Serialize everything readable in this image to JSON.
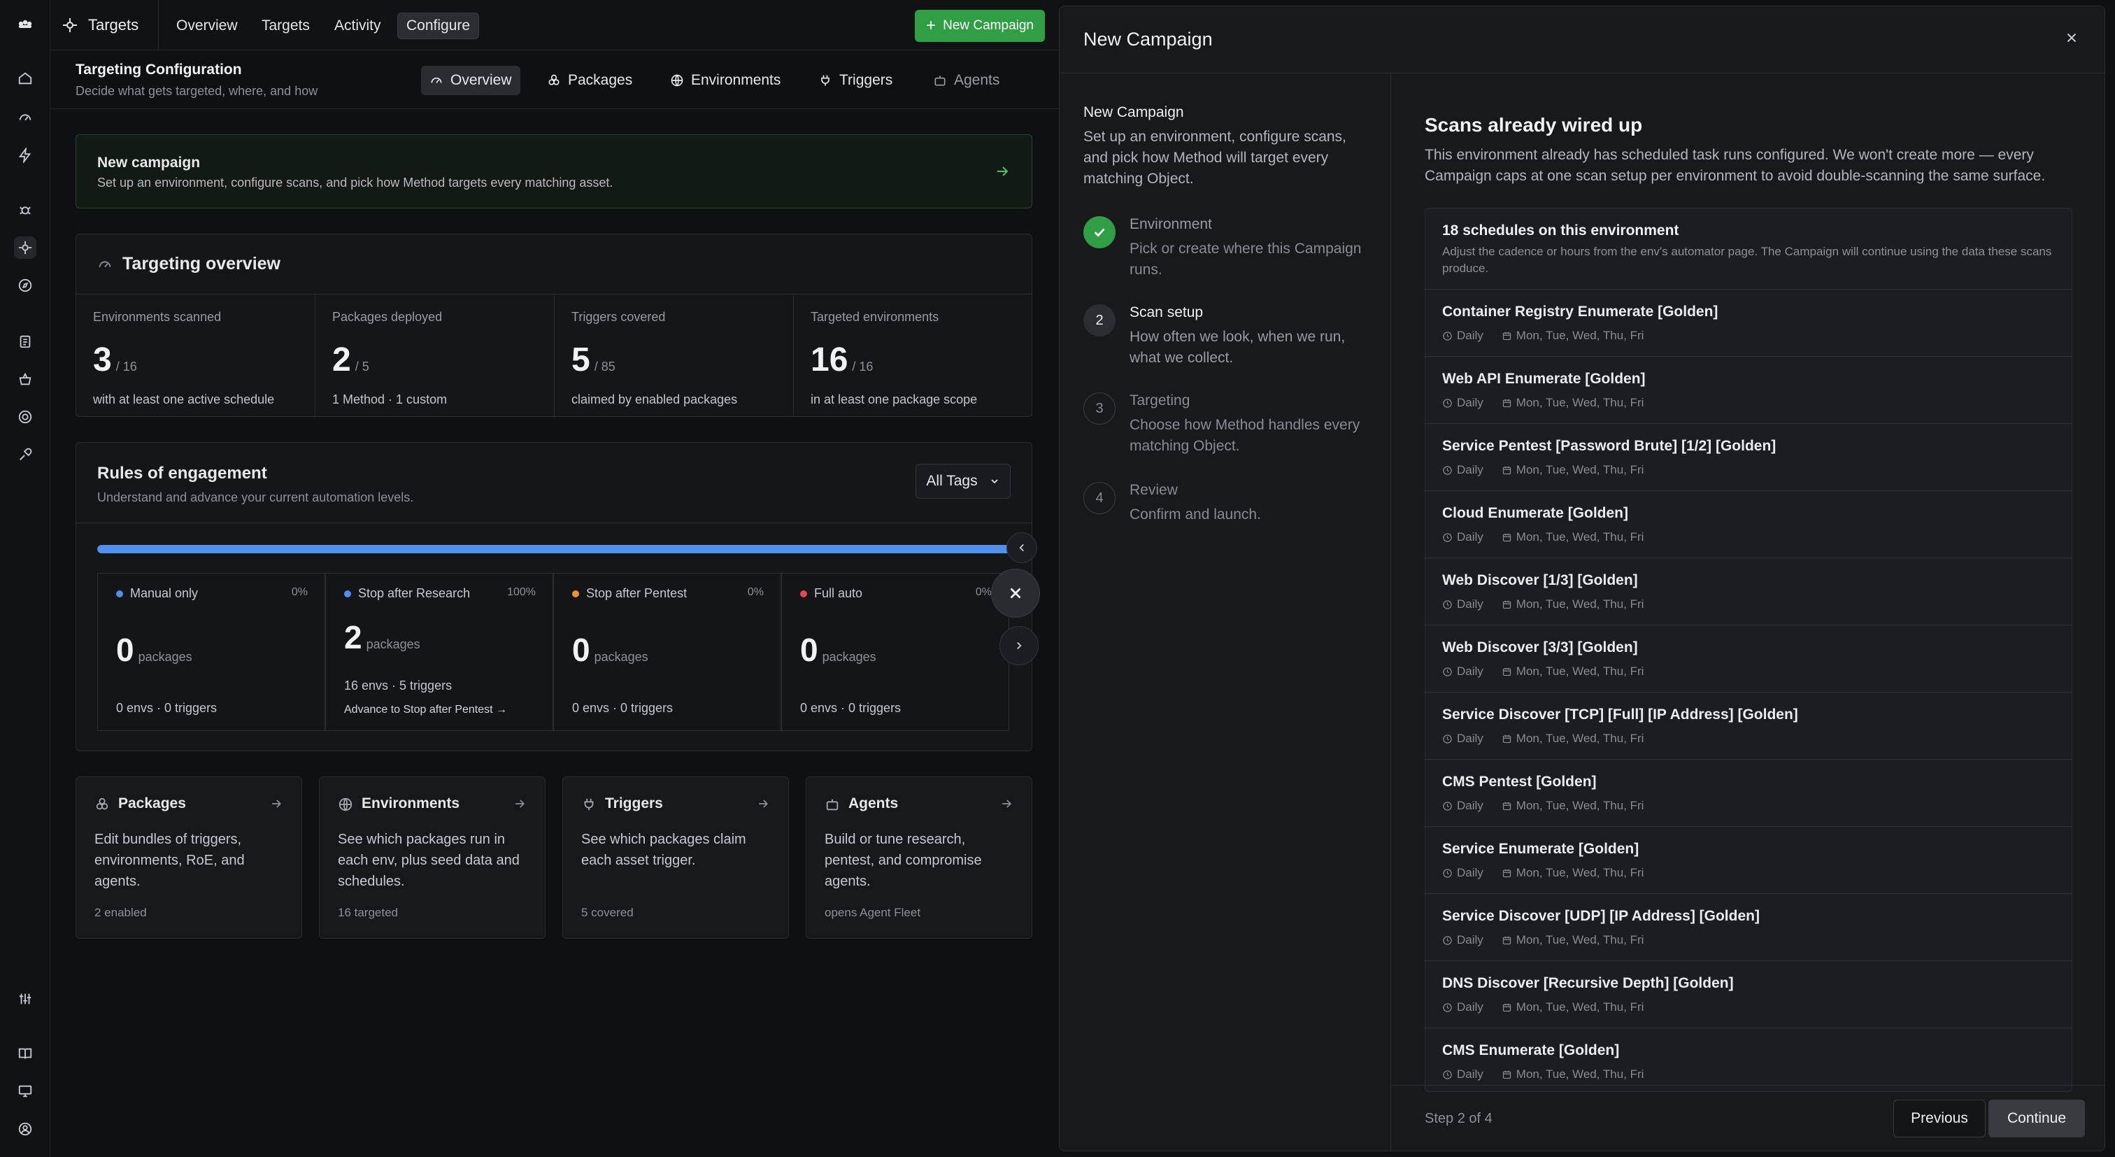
{
  "brand": {
    "label": "Targets"
  },
  "topnav": [
    {
      "label": "Overview"
    },
    {
      "label": "Targets"
    },
    {
      "label": "Activity"
    },
    {
      "label": "Configure"
    }
  ],
  "new_campaign_button": "New Campaign",
  "subheader": {
    "title": "Targeting Configuration",
    "desc": "Decide what gets targeted, where, and how",
    "tabs": [
      {
        "label": "Overview",
        "icon": "gauge-icon"
      },
      {
        "label": "Packages",
        "icon": "packages-icon"
      },
      {
        "label": "Environments",
        "icon": "globe-icon"
      },
      {
        "label": "Triggers",
        "icon": "plug-icon"
      },
      {
        "label": "Agents",
        "icon": "bot-icon"
      }
    ]
  },
  "new_campaign_card": {
    "title": "New campaign",
    "desc": "Set up an environment, configure scans, and pick how Method targets every matching asset."
  },
  "targeting_overview": {
    "title": "Targeting overview",
    "stats": [
      {
        "label": "Environments scanned",
        "value": "3",
        "total": "/ 16",
        "foot": "with at least one active schedule"
      },
      {
        "label": "Packages deployed",
        "value": "2",
        "total": "/ 5",
        "foot": "1 Method · 1 custom"
      },
      {
        "label": "Triggers covered",
        "value": "5",
        "total": "/ 85",
        "foot": "claimed by enabled packages"
      },
      {
        "label": "Targeted environments",
        "value": "16",
        "total": "/ 16",
        "foot": "in at least one package scope"
      }
    ]
  },
  "roe": {
    "title": "Rules of engagement",
    "desc": "Understand and advance your current automation levels.",
    "tags_button": "All Tags",
    "progress_fraction": 1.0,
    "levels": [
      {
        "name": "Manual only",
        "pct": "0%",
        "count": "0",
        "unit": "packages",
        "foot": "0 envs · 0 triggers",
        "color": "#4f8ff0"
      },
      {
        "name": "Stop after Research",
        "pct": "100%",
        "count": "2",
        "unit": "packages",
        "foot": "16 envs · 5 triggers",
        "advance": "Advance to Stop after Pentest →",
        "color": "#4f8ff0"
      },
      {
        "name": "Stop after Pentest",
        "pct": "0%",
        "count": "0",
        "unit": "packages",
        "foot": "0 envs · 0 triggers",
        "color": "#f0902f"
      },
      {
        "name": "Full auto",
        "pct": "0%",
        "count": "0",
        "unit": "packages",
        "foot": "0 envs · 0 triggers",
        "color": "#e5484d"
      }
    ]
  },
  "nav_cards": [
    {
      "title": "Packages",
      "desc": "Edit bundles of triggers, environments, RoE, and agents.",
      "foot": "2 enabled"
    },
    {
      "title": "Environments",
      "desc": "See which packages run in each env, plus seed data and schedules.",
      "foot": "16 targeted"
    },
    {
      "title": "Triggers",
      "desc": "See which packages claim each asset trigger.",
      "foot": "5 covered"
    },
    {
      "title": "Agents",
      "desc": "Build or tune research, pentest, and compromise agents.",
      "foot": "opens Agent Fleet"
    }
  ],
  "panel": {
    "title": "New Campaign",
    "intro_title": "New Campaign",
    "intro_desc": "Set up an environment, configure scans, and pick how Method will target every matching Object.",
    "steps": [
      {
        "num": "✓",
        "title": "Environment",
        "desc": "Pick or create where this Campaign runs.",
        "state": "done"
      },
      {
        "num": "2",
        "title": "Scan setup",
        "desc": "How often we look, when we run, what we collect.",
        "state": "current"
      },
      {
        "num": "3",
        "title": "Targeting",
        "desc": "Choose how Method handles every matching Object.",
        "state": "pending"
      },
      {
        "num": "4",
        "title": "Review",
        "desc": "Confirm and launch.",
        "state": "pending"
      }
    ],
    "wire_title": "Scans already wired up",
    "wire_desc": "This environment already has scheduled task runs configured. We won't create more — every Campaign caps at one scan setup per environment to avoid double-scanning the same surface.",
    "schedules_count": "18 schedules on this environment",
    "schedules_note": "Adjust the cadence or hours from the env's automator page. The Campaign will continue using the data these scans produce.",
    "schedules": [
      {
        "name": "Container Registry Enumerate [Golden]",
        "freq": "Daily",
        "days": "Mon, Tue, Wed, Thu, Fri"
      },
      {
        "name": "Web API Enumerate [Golden]",
        "freq": "Daily",
        "days": "Mon, Tue, Wed, Thu, Fri"
      },
      {
        "name": "Service Pentest [Password Brute] [1/2] [Golden]",
        "freq": "Daily",
        "days": "Mon, Tue, Wed, Thu, Fri"
      },
      {
        "name": "Cloud Enumerate [Golden]",
        "freq": "Daily",
        "days": "Mon, Tue, Wed, Thu, Fri"
      },
      {
        "name": "Web Discover [1/3] [Golden]",
        "freq": "Daily",
        "days": "Mon, Tue, Wed, Thu, Fri"
      },
      {
        "name": "Web Discover [3/3] [Golden]",
        "freq": "Daily",
        "days": "Mon, Tue, Wed, Thu, Fri"
      },
      {
        "name": "Service Discover [TCP] [Full] [IP Address] [Golden]",
        "freq": "Daily",
        "days": "Mon, Tue, Wed, Thu, Fri"
      },
      {
        "name": "CMS Pentest [Golden]",
        "freq": "Daily",
        "days": "Mon, Tue, Wed, Thu, Fri"
      },
      {
        "name": "Service Enumerate [Golden]",
        "freq": "Daily",
        "days": "Mon, Tue, Wed, Thu, Fri"
      },
      {
        "name": "Service Discover [UDP] [IP Address] [Golden]",
        "freq": "Daily",
        "days": "Mon, Tue, Wed, Thu, Fri"
      },
      {
        "name": "DNS Discover [Recursive Depth] [Golden]",
        "freq": "Daily",
        "days": "Mon, Tue, Wed, Thu, Fri"
      },
      {
        "name": "CMS Enumerate [Golden]",
        "freq": "Daily",
        "days": "Mon, Tue, Wed, Thu, Fri"
      }
    ],
    "step_counter": "Step 2 of 4",
    "prev_button": "Previous",
    "continue_button": "Continue"
  },
  "colors": {
    "accent_green": "#2f9e44",
    "progress_blue": "#4f8ff0"
  }
}
